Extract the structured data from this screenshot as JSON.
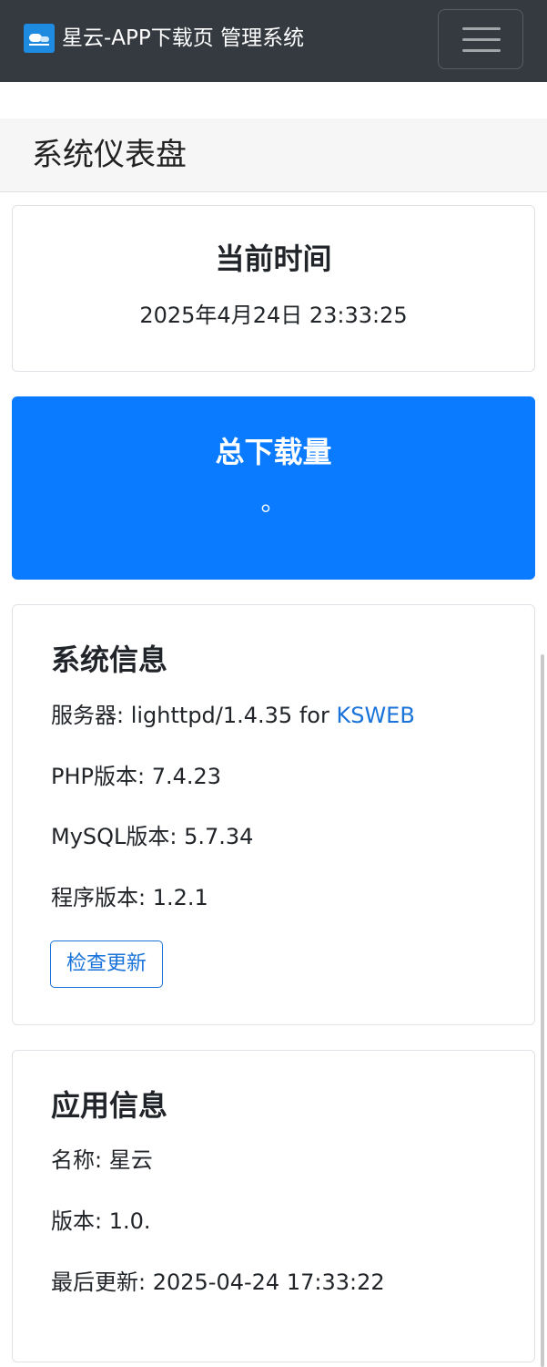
{
  "navbar": {
    "title": "星云-APP下载页 管理系统",
    "logo_icon": "cloud-logo-icon",
    "menu_icon": "hamburger-menu-icon"
  },
  "header": {
    "title": "系统仪表盘"
  },
  "time_card": {
    "title": "当前时间",
    "value": "2025年4月24日 23:33:25"
  },
  "downloads_card": {
    "title": "总下载量",
    "value": "。",
    "color": "#0a7bff"
  },
  "system_info": {
    "title": "系统信息",
    "server_label": "服务器: lighttpd/1.4.35 for ",
    "server_link": "KSWEB",
    "php": "PHP版本: 7.4.23",
    "mysql": "MySQL版本: 5.7.34",
    "program": "程序版本: 1.2.1",
    "check_update_label": "检查更新"
  },
  "app_info": {
    "title": "应用信息",
    "name": "名称: 星云",
    "version": "版本: 1.0.",
    "last_update": "最后更新: 2025-04-24 17:33:22"
  },
  "colors": {
    "navbar": "#343a40",
    "primary": "#0a7bff",
    "link": "#1a73d9"
  }
}
